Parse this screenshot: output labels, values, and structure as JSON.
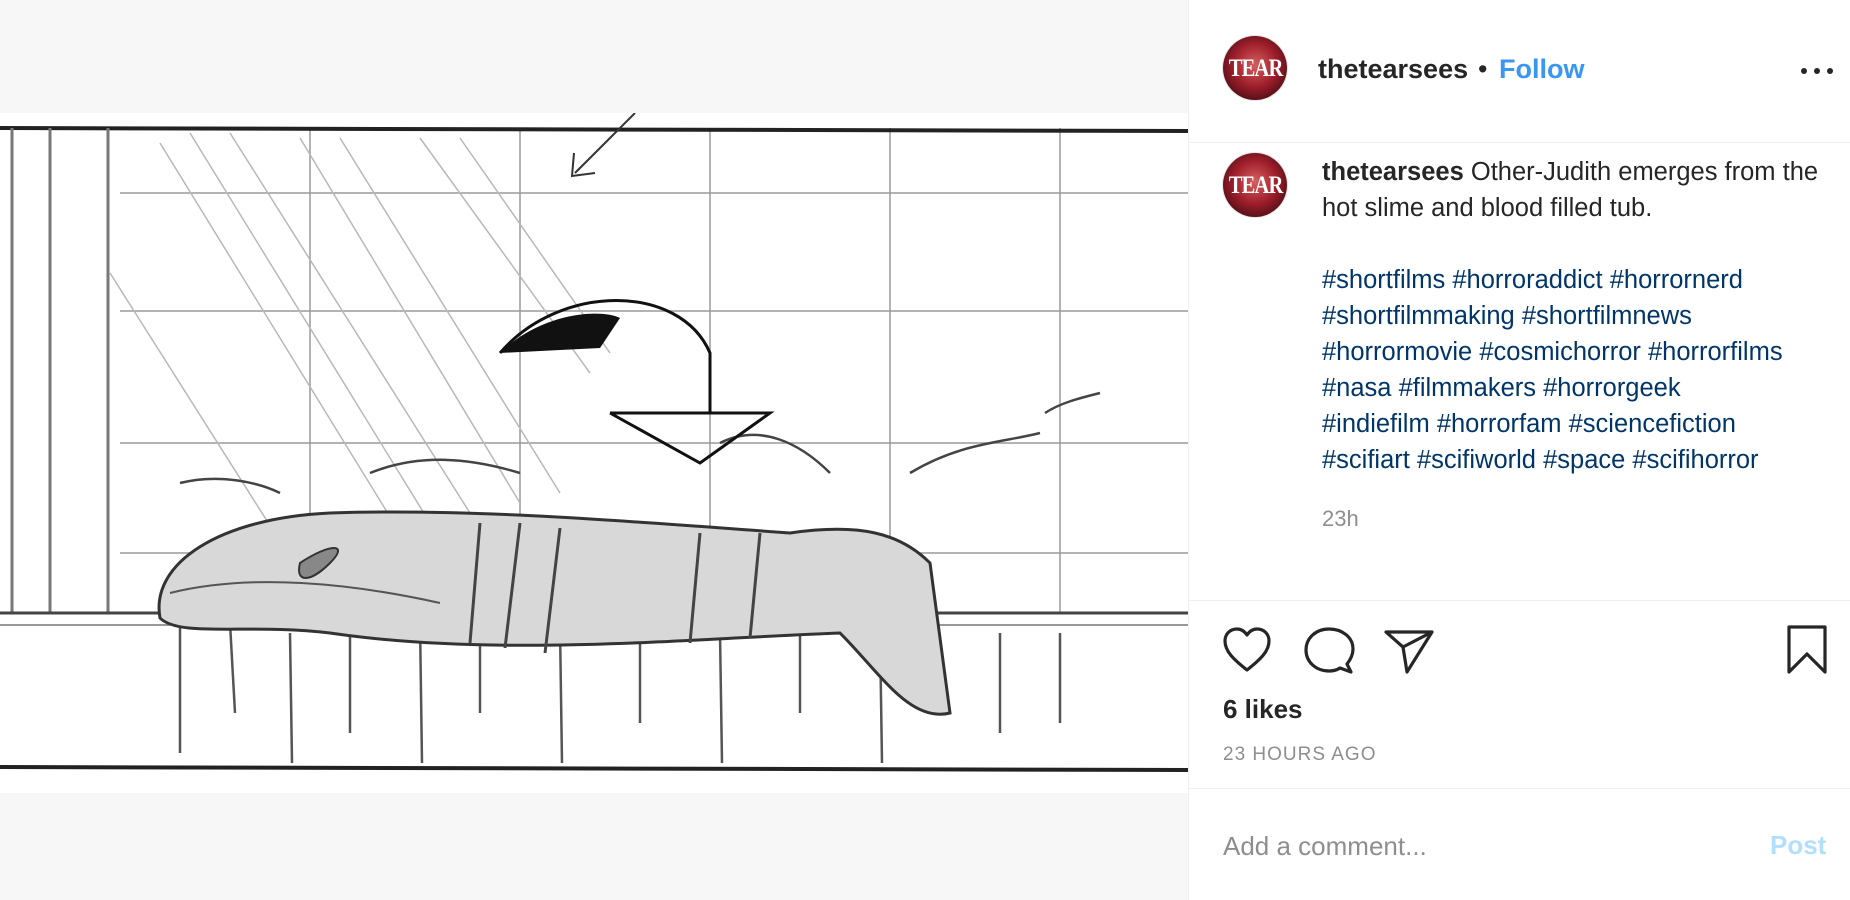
{
  "post": {
    "username": "thetearsees",
    "avatar_text": "TEAR",
    "dot": "•",
    "follow_label": "Follow",
    "more_icon": "more-horizontal-icon",
    "caption_text": "Other-Judith emerges from the hot slime and blood filled tub.",
    "hashtags": [
      "#shortfilms",
      "#horroraddict",
      "#horrornerd",
      "#shortfilmmaking",
      "#shortfilmnews",
      "#horrormovie",
      "#cosmichorror",
      "#horrorfilms",
      "#nasa",
      "#filmmakers",
      "#horrorgeek",
      "#indiefilm",
      "#horrorfam",
      "#sciencefiction",
      "#scifiart",
      "#scifiworld",
      "#space",
      "#scifihorror"
    ],
    "caption_time": "23h",
    "likes": "6 likes",
    "date": "23 HOURS AGO",
    "comment_placeholder": "Add a comment...",
    "post_label": "Post"
  },
  "icons": [
    "heart-icon",
    "comment-icon",
    "share-icon",
    "bookmark-icon"
  ],
  "colors": {
    "link_blue": "#3897f0",
    "hashtag": "#003569",
    "muted": "#8e8e8e",
    "post_disabled": "#b2dffc",
    "avatar_red": "#a01f2c"
  }
}
